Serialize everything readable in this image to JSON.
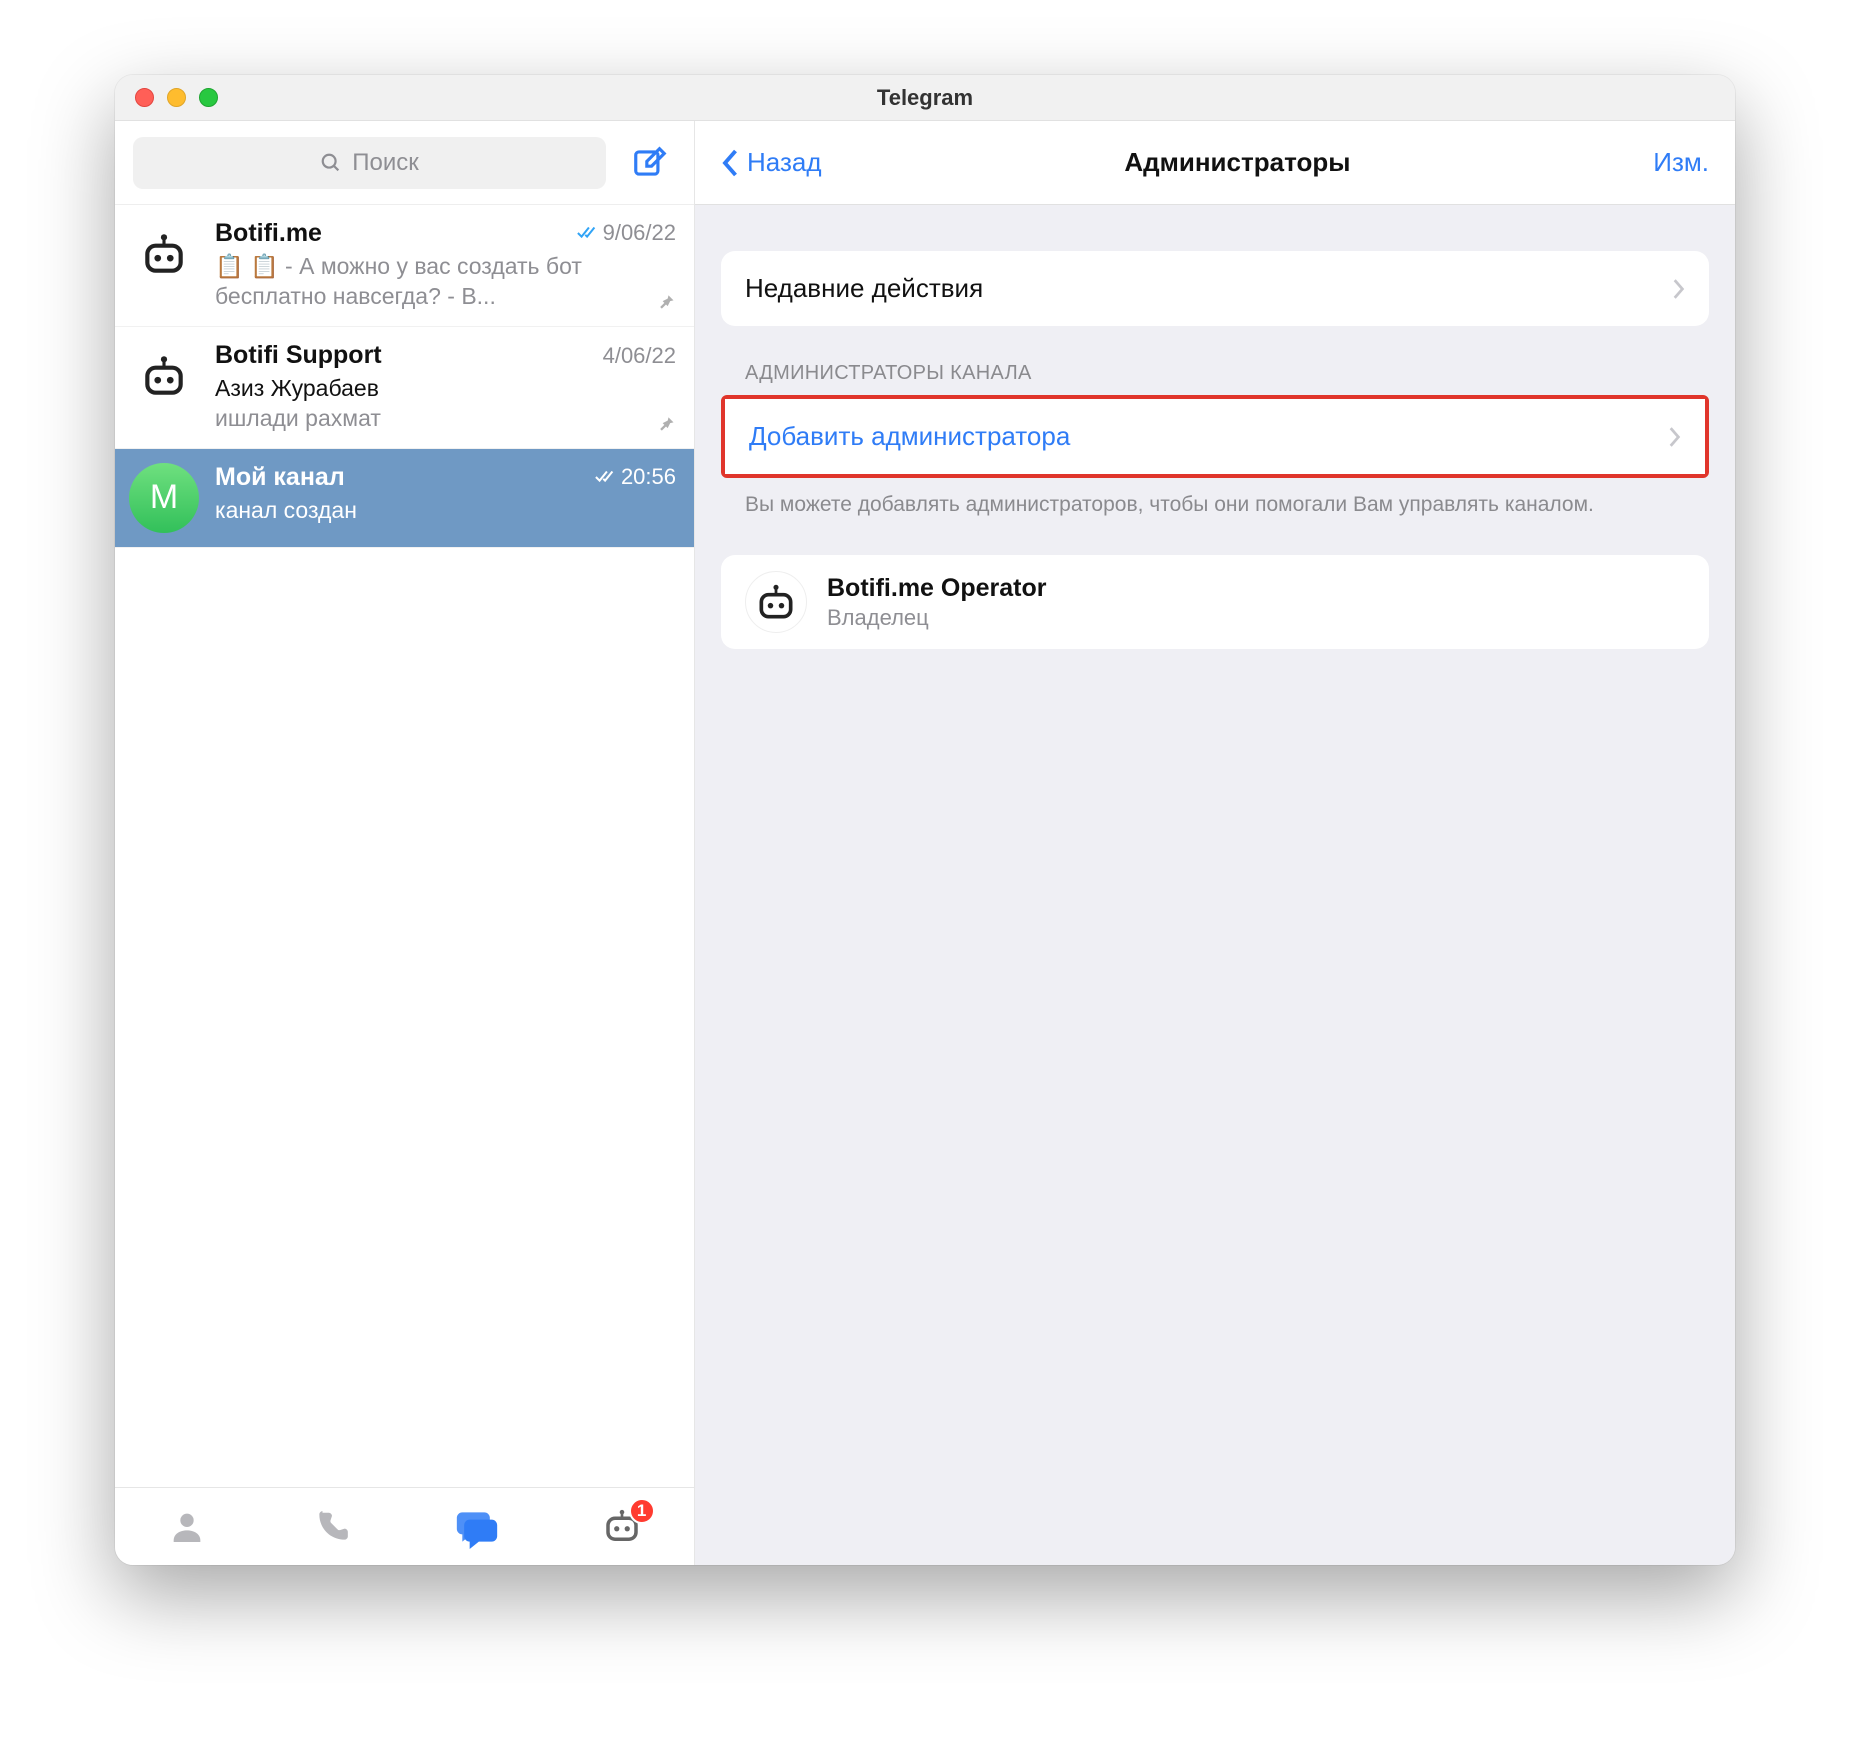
{
  "titlebar": {
    "title": "Telegram"
  },
  "sidebar": {
    "search_placeholder": "Поиск",
    "chats": [
      {
        "name": "Botifi.me",
        "date": "9/06/22",
        "preview": "📋 📋 - А можно у вас создать бот бесплатно навсегда? - В...",
        "read": true,
        "pinned": true,
        "avatar_kind": "bot",
        "avatar_letter": ""
      },
      {
        "name": "Botifi Support",
        "date": "4/06/22",
        "preview_line1": "Азиз Журабаев",
        "preview_line2": "ишлади рахмат",
        "read": false,
        "pinned": true,
        "avatar_kind": "bot",
        "avatar_letter": ""
      },
      {
        "name": "Мой канал",
        "date": "20:56",
        "preview": "канал создан",
        "read": true,
        "pinned": false,
        "avatar_kind": "letter",
        "avatar_letter": "M",
        "selected": true
      }
    ],
    "tabs_badge": "1"
  },
  "main": {
    "back_label": "Назад",
    "title": "Администраторы",
    "edit_label": "Изм.",
    "recent_actions": "Недавние действия",
    "section_header": "АДМИНИСТРАТОРЫ КАНАЛА",
    "add_admin": "Добавить администратора",
    "help_text": "Вы можете добавлять администраторов, чтобы они помогали Вам управлять каналом.",
    "admins": [
      {
        "name": "Botifi.me Operator",
        "role": "Владелец"
      }
    ]
  }
}
